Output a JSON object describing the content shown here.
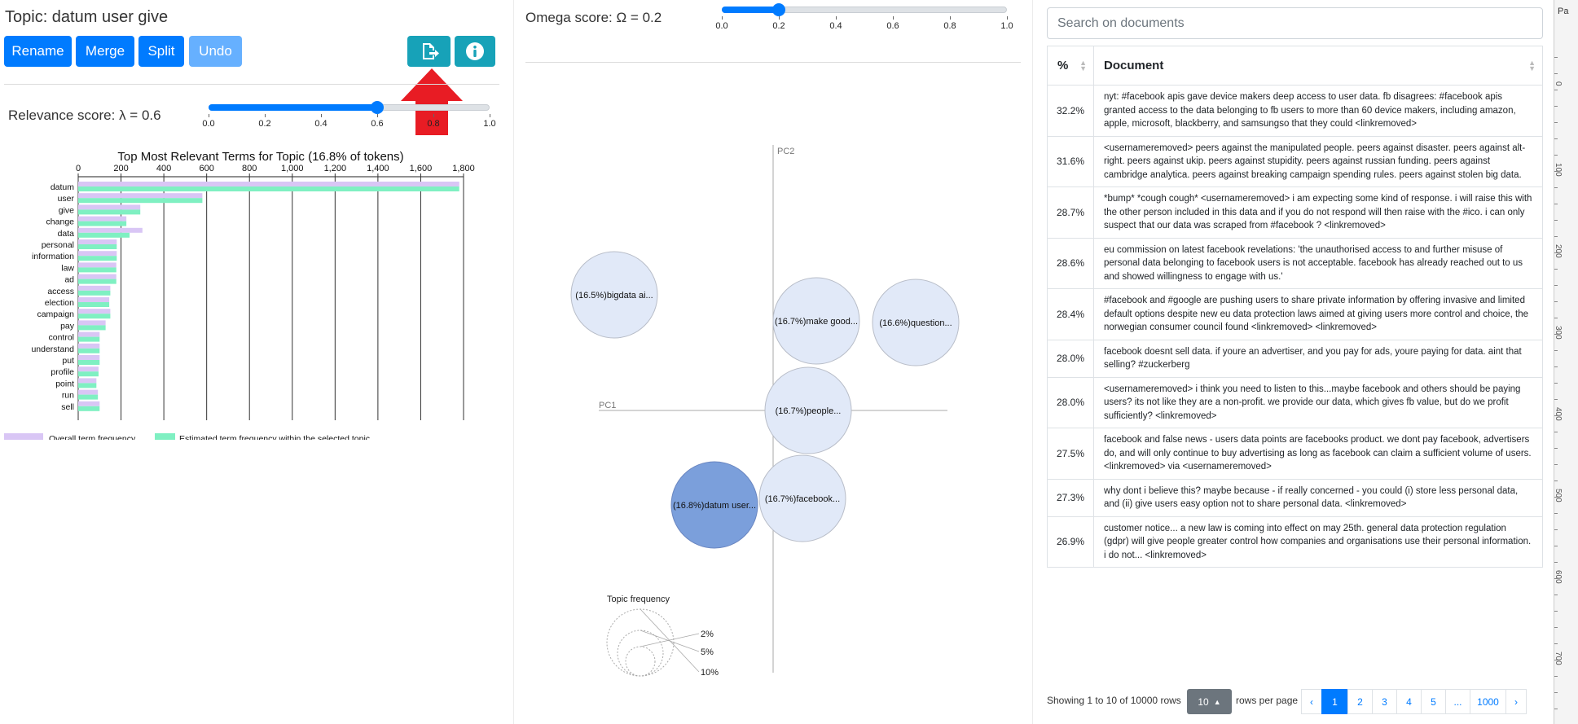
{
  "topic": {
    "title": "Topic: datum user give"
  },
  "buttons": {
    "rename": "Rename",
    "merge": "Merge",
    "split": "Split",
    "undo": "Undo"
  },
  "icons": {
    "export": "export-file-icon",
    "info": "info-icon",
    "arrow": "red-arrow-up-icon"
  },
  "relevance": {
    "label": "Relevance score: λ = 0.6",
    "value": 0.6,
    "ticks": [
      "0.0",
      "0.2",
      "0.4",
      "0.6",
      "0.8",
      "1.0"
    ]
  },
  "omega": {
    "label": "Omega score: Ω = 0.2",
    "value": 0.2,
    "ticks": [
      "0.0",
      "0.2",
      "0.4",
      "0.6",
      "0.8",
      "1.0"
    ]
  },
  "chart_data": [
    {
      "type": "bar",
      "title": "Top Most Relevant Terms for Topic (16.8% of tokens)",
      "categories": [
        "datum",
        "user",
        "give",
        "change",
        "data",
        "personal",
        "information",
        "law",
        "ad",
        "access",
        "election",
        "campaign",
        "pay",
        "control",
        "understand",
        "put",
        "profile",
        "point",
        "run",
        "sell"
      ],
      "series": [
        {
          "name": "Overall term frequency",
          "color": "#d9c6f5",
          "values": [
            1780,
            580,
            290,
            225,
            300,
            180,
            180,
            178,
            178,
            150,
            145,
            150,
            128,
            100,
            100,
            100,
            95,
            85,
            92,
            100
          ]
        },
        {
          "name": "Estimated term frequency within the selected topic",
          "color": "#7ff0c2",
          "values": [
            1780,
            580,
            290,
            225,
            240,
            180,
            180,
            178,
            178,
            150,
            145,
            150,
            128,
            100,
            100,
            100,
            95,
            85,
            92,
            100
          ]
        }
      ],
      "xticks": [
        "0",
        "200",
        "400",
        "600",
        "800",
        "1,000",
        "1,200",
        "1,400",
        "1,600",
        "1,800"
      ],
      "xlim": [
        0,
        1800
      ]
    },
    {
      "type": "scatter",
      "xlabel": "PC1",
      "ylabel": "PC2",
      "points": [
        {
          "label": "(16.5%)bigdata ai...",
          "selected": false
        },
        {
          "label": "(16.7%)make good...",
          "selected": false
        },
        {
          "label": "(16.6%)question...",
          "selected": false
        },
        {
          "label": "(16.7%)people...",
          "selected": false
        },
        {
          "label": "(16.8%)datum user...",
          "selected": true
        },
        {
          "label": "(16.7%)facebook...",
          "selected": false
        }
      ],
      "size_legend": {
        "title": "Topic frequency",
        "labels": [
          "2%",
          "5%",
          "10%"
        ]
      }
    }
  ],
  "search": {
    "placeholder": "Search on documents"
  },
  "table": {
    "headers": [
      "%",
      "Document"
    ],
    "rows": [
      {
        "pct": "32.2%",
        "doc": "nyt: #facebook apis gave device makers deep access to user data. fb disagrees: #facebook apis granted access to the data belonging to fb users to more than 60 device makers, including amazon, apple, microsoft, blackberry, and samsungso that they could <linkremoved>"
      },
      {
        "pct": "31.6%",
        "doc": "<usernameremoved> peers against the manipulated people. peers against disaster. peers against alt-right. peers against ukip. peers against stupidity. peers against russian funding. peers against cambridge analytica. peers against breaking campaign spending rules. peers against stolen big data."
      },
      {
        "pct": "28.7%",
        "doc": "*bump* *cough cough* <usernameremoved> i am expecting some kind of response. i will raise this with the other person included in this data and if you do not respond will then raise with the #ico. i can only suspect that our data was scraped from #facebook ? <linkremoved>"
      },
      {
        "pct": "28.6%",
        "doc": "eu commission on latest facebook revelations: 'the unauthorised access to and further misuse of personal data belonging to facebook users is not acceptable. facebook has already reached out to us and showed willingness to engage with us.'"
      },
      {
        "pct": "28.4%",
        "doc": "#facebook and #google are pushing users to share private information by offering invasive and limited default options despite new eu data protection laws aimed at giving users more control and choice, the norwegian consumer council found <linkremoved> <linkremoved>"
      },
      {
        "pct": "28.0%",
        "doc": "facebook doesnt sell data. if youre an advertiser, and you pay for ads, youre paying for data. aint that selling? #zuckerberg"
      },
      {
        "pct": "28.0%",
        "doc": "<usernameremoved> i think you need to listen to this...maybe facebook and others should be paying users? its not like they are a non-profit. we provide our data, which gives fb value, but do we profit sufficiently? <linkremoved>"
      },
      {
        "pct": "27.5%",
        "doc": "facebook and false news - users data points are facebooks product. we dont pay facebook, advertisers do, and will only continue to buy advertising as long as facebook can claim a sufficient volume of users. <linkremoved> via <usernameremoved>"
      },
      {
        "pct": "27.3%",
        "doc": "why dont i believe this? maybe because - if really concerned - you could (i) store less personal data, and (ii) give users easy option not to share personal data. <linkremoved>"
      },
      {
        "pct": "26.9%",
        "doc": "customer notice... a new law is coming into effect on may 25th. general data protection regulation (gdpr) will give people greater control how companies and organisations use their personal information. i do not... <linkremoved>"
      }
    ]
  },
  "pagination": {
    "showing": "Showing 1 to 10 of 10000 rows",
    "rows_value": "10",
    "rows_per_page": "rows per page",
    "pages": [
      "‹",
      "1",
      "2",
      "3",
      "4",
      "5",
      "...",
      "1000",
      "›"
    ],
    "active": "1"
  },
  "ruler": {
    "labels": [
      "0",
      "100",
      "200",
      "300",
      "400",
      "500",
      "600",
      "700"
    ],
    "corner": "Pa"
  }
}
